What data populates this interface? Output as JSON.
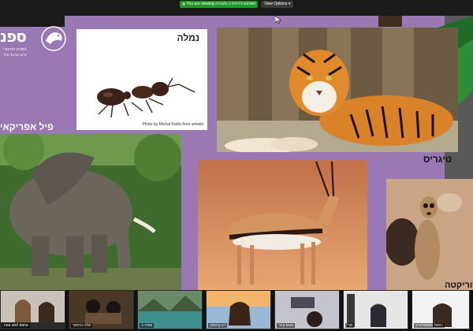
{
  "share": {
    "status_text": "You are viewing רונית ב.מערכת's screen",
    "view_options_label": "View Options",
    "view_options_caret": "▾",
    "color": "#1f9a2a"
  },
  "slide": {
    "logo": {
      "main": "ספנ",
      "line1": "המרכז החינוכי",
      "line2": "ע\"ש ישראל פלד"
    },
    "ant": {
      "label": "נמלה",
      "credit": "Photo by Michal Kukla from antwiki"
    },
    "tiger": {
      "label": "טיגריס"
    },
    "elephant": {
      "label": "פיל אפריקאי"
    },
    "meerkat": {
      "label": "סוריקטה"
    },
    "background_color": "#9a78b4"
  },
  "participants": [
    {
      "name": "noa and dana"
    },
    {
      "name": "אלה כרמוני"
    },
    {
      "name": "גאיה ב"
    },
    {
      "name": "רון קינסקי"
    },
    {
      "name": "נועם קיזר"
    },
    {
      "name": "מרי"
    },
    {
      "name": "רפאל שמואליביץ"
    }
  ]
}
